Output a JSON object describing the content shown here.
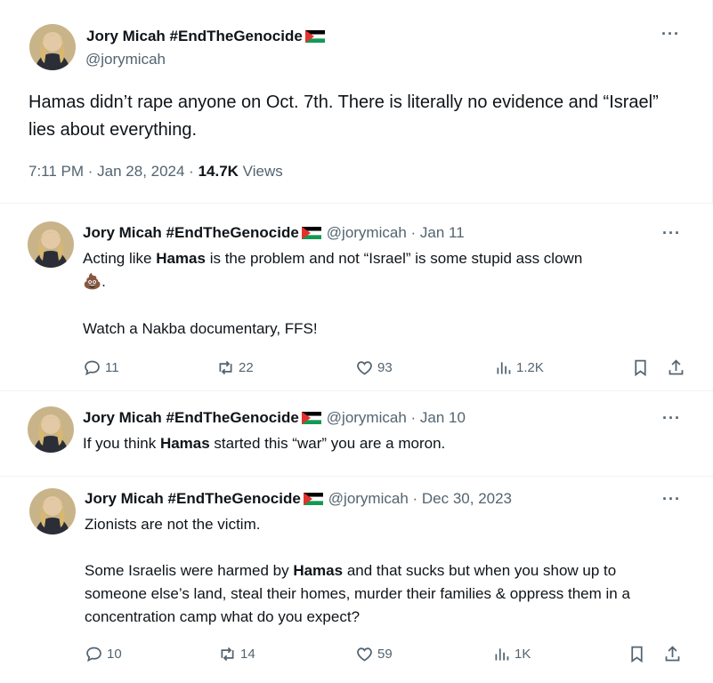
{
  "main_tweet": {
    "name": "Jory Micah #EndTheGenocide",
    "handle": "@jorymicah",
    "more": "···",
    "text": "Hamas didn’t rape anyone on Oct. 7th. There is literally no evidence and “Israel” lies about everything.",
    "time": "7:11 PM · Jan 28, 2024 · ",
    "views_count": "14.7K",
    "views_label": " Views"
  },
  "replies": [
    {
      "name": "Jory Micah #EndTheGenocide",
      "handle_date": "@jorymicah · Jan 11",
      "more": "···",
      "line1_pre": "Acting like ",
      "line1_bold": "Hamas",
      "line1_post": " is the problem and not “Israel” is some stupid ass clown",
      "emoji": "💩",
      "line1_end": ".",
      "line2": "Watch a Nakba documentary, FFS!",
      "replies": "11",
      "reposts": "22",
      "likes": "93",
      "views": "1.2K"
    },
    {
      "name": "Jory Micah #EndTheGenocide",
      "handle_date": "@jorymicah · Jan 10",
      "more": "···",
      "line1_pre": "If you think ",
      "line1_bold": "Hamas",
      "line1_post": " started this “war” you are a moron."
    },
    {
      "name": "Jory Micah #EndTheGenocide",
      "handle_date": "@jorymicah · Dec 30, 2023",
      "more": "···",
      "line1": "Zionists are not the victim.",
      "line2_pre": "Some Israelis were harmed by ",
      "line2_bold": "Hamas",
      "line2_post": " and that sucks but when you show up to someone else’s land, steal their homes, murder their families & oppress them in a concentration camp what do you expect?",
      "replies": "10",
      "reposts": "14",
      "likes": "59",
      "views": "1K"
    }
  ],
  "colors": {
    "text": "#0f1419",
    "secondary": "#536471",
    "divider": "#eff3f4",
    "flag_black": "#000000",
    "flag_green": "#149954",
    "flag_red": "#e4312b"
  },
  "icons": [
    "reply-icon",
    "repost-icon",
    "like-icon",
    "views-icon",
    "bookmark-icon",
    "share-icon",
    "palestine-flag-icon",
    "pile-of-poo-emoji"
  ]
}
